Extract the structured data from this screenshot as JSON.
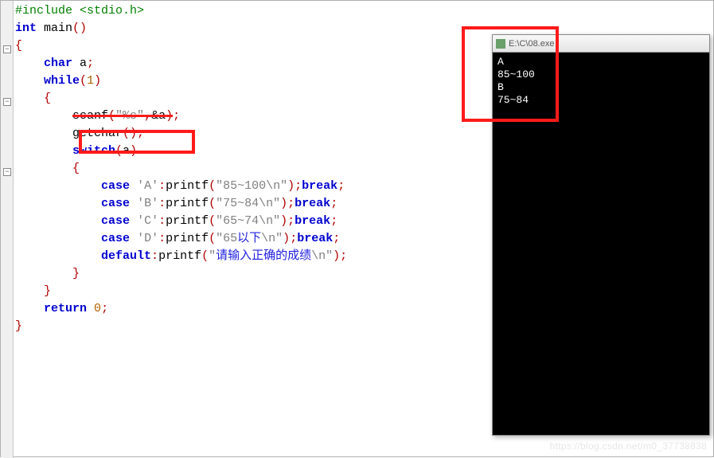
{
  "code": {
    "include": "#include <stdio.h>",
    "int": "int",
    "main": "main",
    "char": "char",
    "a_decl": " a",
    "while": "while",
    "one": "1",
    "scanf": "scanf",
    "scanf_fmt": "\"%c\"",
    "scanf_arg": "&a",
    "getchar": "getchar",
    "switch": "switch",
    "svar": "a",
    "case": "case",
    "cA": "'A'",
    "cB": "'B'",
    "cC": "'C'",
    "cD": "'D'",
    "printf": "printf",
    "sA": "\"85~100\\n\"",
    "sB": "\"75~84\\n\"",
    "sC": "\"65~74\\n\"",
    "sD_pre": "\"65",
    "sD_cn": "以下",
    "sD_post": "\\n\"",
    "sDef_pre": "\"",
    "sDef_cn": "请输入正确的成绩",
    "sDef_post": "\\n\"",
    "break": "break",
    "default": "default",
    "return": "return",
    "zero": "0"
  },
  "console": {
    "title": "E:\\C\\08.exe",
    "out1": "A",
    "out2": "85~100",
    "out3": "B",
    "out4": "75~84"
  },
  "watermark": "https://blog.csdn.net/m0_37738838"
}
